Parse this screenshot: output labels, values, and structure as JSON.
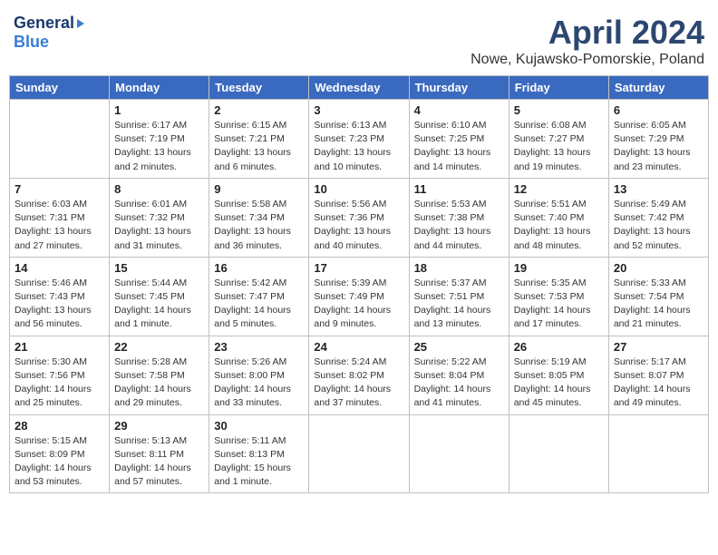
{
  "logo": {
    "general": "General",
    "blue": "Blue"
  },
  "title": {
    "month_year": "April 2024",
    "location": "Nowe, Kujawsko-Pomorskie, Poland"
  },
  "weekdays": [
    "Sunday",
    "Monday",
    "Tuesday",
    "Wednesday",
    "Thursday",
    "Friday",
    "Saturday"
  ],
  "weeks": [
    [
      {
        "day": "",
        "sunrise": "",
        "sunset": "",
        "daylight": ""
      },
      {
        "day": "1",
        "sunrise": "Sunrise: 6:17 AM",
        "sunset": "Sunset: 7:19 PM",
        "daylight": "Daylight: 13 hours and 2 minutes."
      },
      {
        "day": "2",
        "sunrise": "Sunrise: 6:15 AM",
        "sunset": "Sunset: 7:21 PM",
        "daylight": "Daylight: 13 hours and 6 minutes."
      },
      {
        "day": "3",
        "sunrise": "Sunrise: 6:13 AM",
        "sunset": "Sunset: 7:23 PM",
        "daylight": "Daylight: 13 hours and 10 minutes."
      },
      {
        "day": "4",
        "sunrise": "Sunrise: 6:10 AM",
        "sunset": "Sunset: 7:25 PM",
        "daylight": "Daylight: 13 hours and 14 minutes."
      },
      {
        "day": "5",
        "sunrise": "Sunrise: 6:08 AM",
        "sunset": "Sunset: 7:27 PM",
        "daylight": "Daylight: 13 hours and 19 minutes."
      },
      {
        "day": "6",
        "sunrise": "Sunrise: 6:05 AM",
        "sunset": "Sunset: 7:29 PM",
        "daylight": "Daylight: 13 hours and 23 minutes."
      }
    ],
    [
      {
        "day": "7",
        "sunrise": "Sunrise: 6:03 AM",
        "sunset": "Sunset: 7:31 PM",
        "daylight": "Daylight: 13 hours and 27 minutes."
      },
      {
        "day": "8",
        "sunrise": "Sunrise: 6:01 AM",
        "sunset": "Sunset: 7:32 PM",
        "daylight": "Daylight: 13 hours and 31 minutes."
      },
      {
        "day": "9",
        "sunrise": "Sunrise: 5:58 AM",
        "sunset": "Sunset: 7:34 PM",
        "daylight": "Daylight: 13 hours and 36 minutes."
      },
      {
        "day": "10",
        "sunrise": "Sunrise: 5:56 AM",
        "sunset": "Sunset: 7:36 PM",
        "daylight": "Daylight: 13 hours and 40 minutes."
      },
      {
        "day": "11",
        "sunrise": "Sunrise: 5:53 AM",
        "sunset": "Sunset: 7:38 PM",
        "daylight": "Daylight: 13 hours and 44 minutes."
      },
      {
        "day": "12",
        "sunrise": "Sunrise: 5:51 AM",
        "sunset": "Sunset: 7:40 PM",
        "daylight": "Daylight: 13 hours and 48 minutes."
      },
      {
        "day": "13",
        "sunrise": "Sunrise: 5:49 AM",
        "sunset": "Sunset: 7:42 PM",
        "daylight": "Daylight: 13 hours and 52 minutes."
      }
    ],
    [
      {
        "day": "14",
        "sunrise": "Sunrise: 5:46 AM",
        "sunset": "Sunset: 7:43 PM",
        "daylight": "Daylight: 13 hours and 56 minutes."
      },
      {
        "day": "15",
        "sunrise": "Sunrise: 5:44 AM",
        "sunset": "Sunset: 7:45 PM",
        "daylight": "Daylight: 14 hours and 1 minute."
      },
      {
        "day": "16",
        "sunrise": "Sunrise: 5:42 AM",
        "sunset": "Sunset: 7:47 PM",
        "daylight": "Daylight: 14 hours and 5 minutes."
      },
      {
        "day": "17",
        "sunrise": "Sunrise: 5:39 AM",
        "sunset": "Sunset: 7:49 PM",
        "daylight": "Daylight: 14 hours and 9 minutes."
      },
      {
        "day": "18",
        "sunrise": "Sunrise: 5:37 AM",
        "sunset": "Sunset: 7:51 PM",
        "daylight": "Daylight: 14 hours and 13 minutes."
      },
      {
        "day": "19",
        "sunrise": "Sunrise: 5:35 AM",
        "sunset": "Sunset: 7:53 PM",
        "daylight": "Daylight: 14 hours and 17 minutes."
      },
      {
        "day": "20",
        "sunrise": "Sunrise: 5:33 AM",
        "sunset": "Sunset: 7:54 PM",
        "daylight": "Daylight: 14 hours and 21 minutes."
      }
    ],
    [
      {
        "day": "21",
        "sunrise": "Sunrise: 5:30 AM",
        "sunset": "Sunset: 7:56 PM",
        "daylight": "Daylight: 14 hours and 25 minutes."
      },
      {
        "day": "22",
        "sunrise": "Sunrise: 5:28 AM",
        "sunset": "Sunset: 7:58 PM",
        "daylight": "Daylight: 14 hours and 29 minutes."
      },
      {
        "day": "23",
        "sunrise": "Sunrise: 5:26 AM",
        "sunset": "Sunset: 8:00 PM",
        "daylight": "Daylight: 14 hours and 33 minutes."
      },
      {
        "day": "24",
        "sunrise": "Sunrise: 5:24 AM",
        "sunset": "Sunset: 8:02 PM",
        "daylight": "Daylight: 14 hours and 37 minutes."
      },
      {
        "day": "25",
        "sunrise": "Sunrise: 5:22 AM",
        "sunset": "Sunset: 8:04 PM",
        "daylight": "Daylight: 14 hours and 41 minutes."
      },
      {
        "day": "26",
        "sunrise": "Sunrise: 5:19 AM",
        "sunset": "Sunset: 8:05 PM",
        "daylight": "Daylight: 14 hours and 45 minutes."
      },
      {
        "day": "27",
        "sunrise": "Sunrise: 5:17 AM",
        "sunset": "Sunset: 8:07 PM",
        "daylight": "Daylight: 14 hours and 49 minutes."
      }
    ],
    [
      {
        "day": "28",
        "sunrise": "Sunrise: 5:15 AM",
        "sunset": "Sunset: 8:09 PM",
        "daylight": "Daylight: 14 hours and 53 minutes."
      },
      {
        "day": "29",
        "sunrise": "Sunrise: 5:13 AM",
        "sunset": "Sunset: 8:11 PM",
        "daylight": "Daylight: 14 hours and 57 minutes."
      },
      {
        "day": "30",
        "sunrise": "Sunrise: 5:11 AM",
        "sunset": "Sunset: 8:13 PM",
        "daylight": "Daylight: 15 hours and 1 minute."
      },
      {
        "day": "",
        "sunrise": "",
        "sunset": "",
        "daylight": ""
      },
      {
        "day": "",
        "sunrise": "",
        "sunset": "",
        "daylight": ""
      },
      {
        "day": "",
        "sunrise": "",
        "sunset": "",
        "daylight": ""
      },
      {
        "day": "",
        "sunrise": "",
        "sunset": "",
        "daylight": ""
      }
    ]
  ]
}
